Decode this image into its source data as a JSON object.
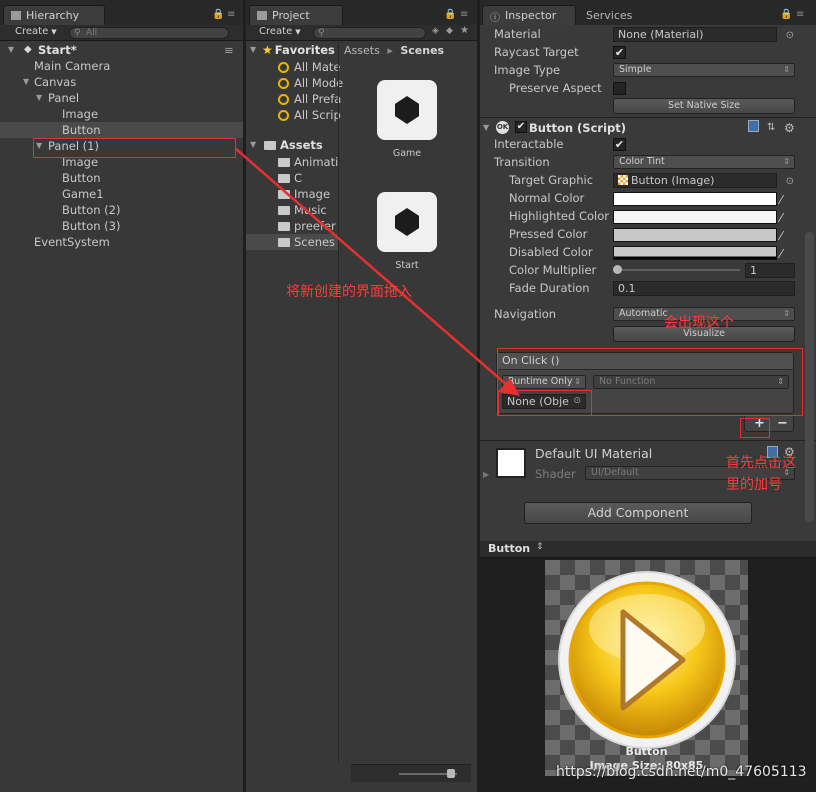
{
  "hierarchy": {
    "tab": "Hierarchy",
    "create": "Create",
    "search_placeholder": "All",
    "scene": "Start*",
    "items": [
      {
        "label": "Main Camera"
      },
      {
        "label": "Canvas"
      },
      {
        "label": "Panel"
      },
      {
        "label": "Image"
      },
      {
        "label": "Button"
      },
      {
        "label": "Panel (1)"
      },
      {
        "label": "Image"
      },
      {
        "label": "Button"
      },
      {
        "label": "Game1"
      },
      {
        "label": "Button (2)"
      },
      {
        "label": "Button (3)"
      },
      {
        "label": "EventSystem"
      }
    ]
  },
  "project": {
    "tab": "Project",
    "create": "Create",
    "favorites": "Favorites",
    "fav_items": [
      "All Mate",
      "All Mode",
      "All Prefa",
      "All Scrip"
    ],
    "assets": "Assets",
    "asset_items": [
      "Animati",
      "C",
      "Image",
      "Music",
      "preefer",
      "Scenes"
    ],
    "breadcrumb": [
      "Assets",
      "Scenes"
    ],
    "files": [
      "Game",
      "Start"
    ]
  },
  "inspector": {
    "tabs": [
      "Inspector",
      "Services"
    ],
    "material_label": "Material",
    "material_value": "None (Material)",
    "raycast_label": "Raycast Target",
    "image_type_label": "Image Type",
    "image_type_value": "Simple",
    "preserve_label": "Preserve Aspect",
    "set_native_size": "Set Native Size",
    "component_title": "Button (Script)",
    "interactable_label": "Interactable",
    "transition_label": "Transition",
    "transition_value": "Color Tint",
    "target_graphic_label": "Target Graphic",
    "target_graphic_value": "Button (Image)",
    "normal_label": "Normal Color",
    "highlighted_label": "Highlighted Color",
    "pressed_label": "Pressed Color",
    "disabled_label": "Disabled Color",
    "multiplier_label": "Color Multiplier",
    "multiplier_value": "1",
    "fade_label": "Fade Duration",
    "fade_value": "0.1",
    "navigation_label": "Navigation",
    "navigation_value": "Automatic",
    "visualize": "Visualize",
    "onclick_header": "On Click ()",
    "runtime_value": "Runtime Only",
    "function_value": "No Function",
    "object_value": "None (Obje",
    "add_symbol": "+",
    "remove_symbol": "−",
    "material_name": "Default UI Material",
    "shader_label": "Shader",
    "shader_value": "UI/Default",
    "add_component": "Add Component"
  },
  "preview": {
    "title": "Button",
    "caption_name": "Button",
    "caption_size": "Image Size: 80x85"
  },
  "annotations": {
    "drag": "将新创建的界面拖入",
    "appear": "会出现这个",
    "click_line1": "首先点击这",
    "click_line2": "里的加号"
  },
  "watermark": "https://blog.csdn.net/m0_47605113",
  "colors": {
    "annotation_red": "#e53030",
    "panel_bg": "#383838",
    "selection": "#4a4a4a",
    "button_gold": "#f5c518"
  }
}
